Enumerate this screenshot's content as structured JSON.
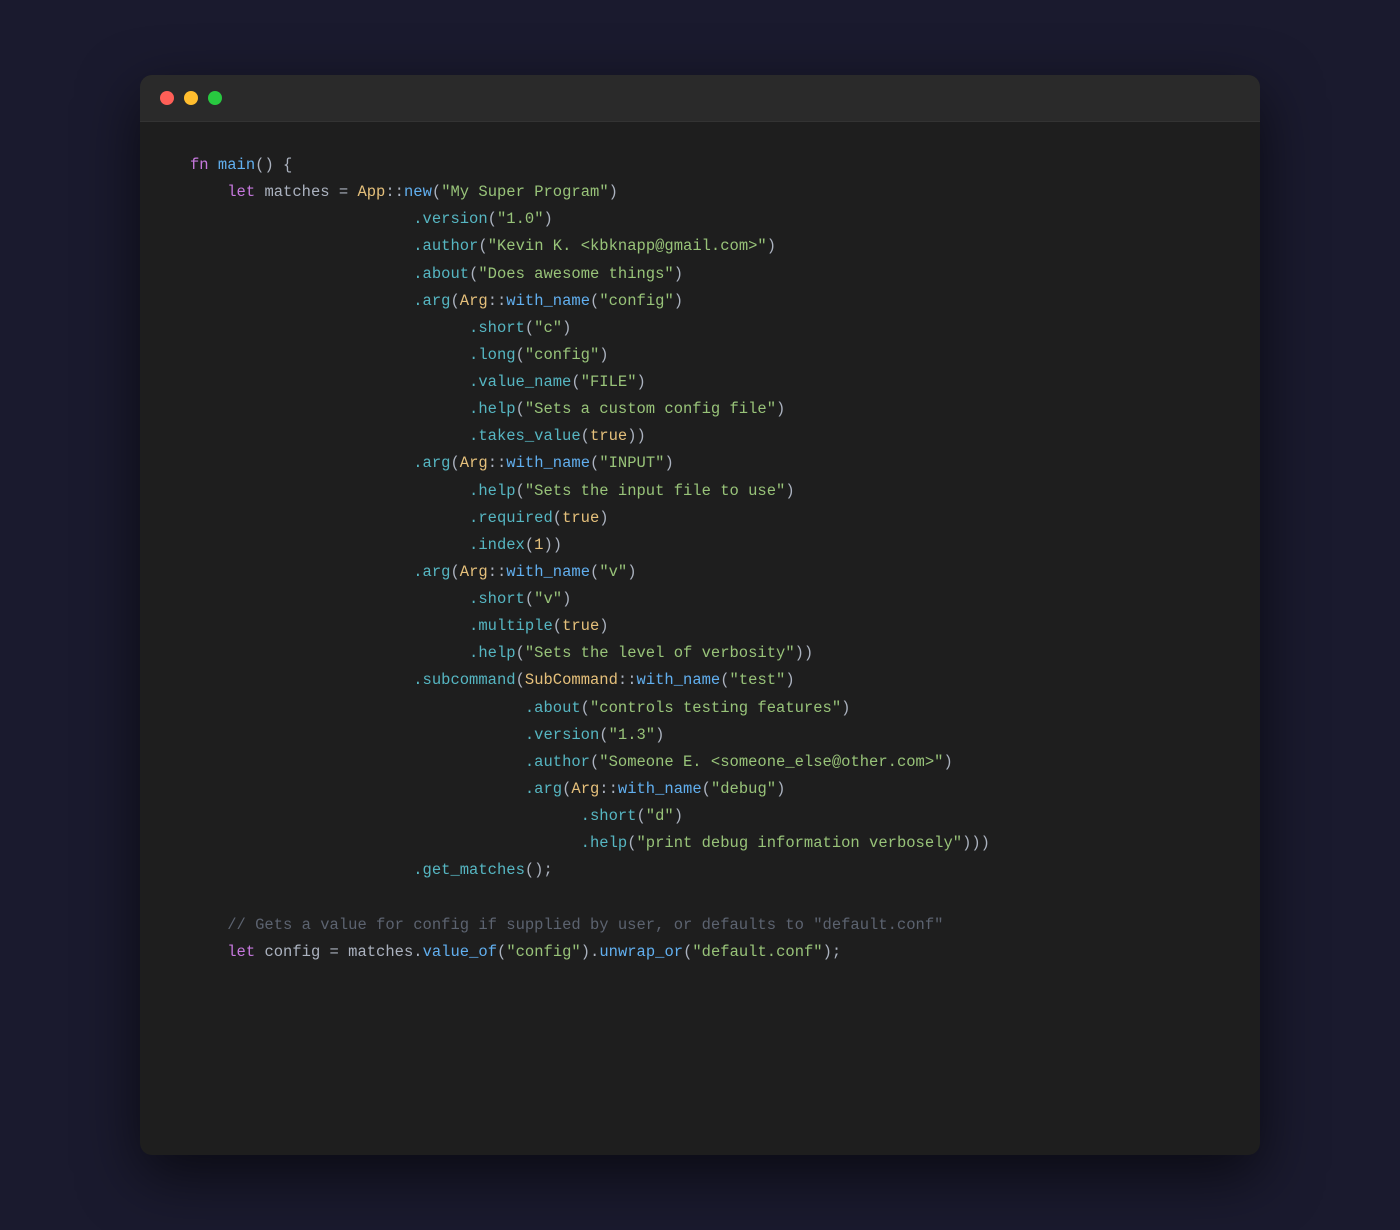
{
  "window": {
    "dots": [
      "red",
      "yellow",
      "green"
    ],
    "dot_labels": [
      "close-dot",
      "minimize-dot",
      "maximize-dot"
    ]
  },
  "code": {
    "lines": [
      {
        "id": 1,
        "content": "fn main() {"
      },
      {
        "id": 2,
        "content": "    let matches = App::new(\"My Super Program\")"
      },
      {
        "id": 3,
        "content": "                        .version(\"1.0\")"
      },
      {
        "id": 4,
        "content": "                        .author(\"Kevin K. <kbknapp@gmail.com>\")"
      },
      {
        "id": 5,
        "content": "                        .about(\"Does awesome things\")"
      },
      {
        "id": 6,
        "content": "                        .arg(Arg::with_name(\"config\")"
      },
      {
        "id": 7,
        "content": "                              .short(\"c\")"
      },
      {
        "id": 8,
        "content": "                              .long(\"config\")"
      },
      {
        "id": 9,
        "content": "                              .value_name(\"FILE\")"
      },
      {
        "id": 10,
        "content": "                              .help(\"Sets a custom config file\")"
      },
      {
        "id": 11,
        "content": "                              .takes_value(true))"
      },
      {
        "id": 12,
        "content": "                        .arg(Arg::with_name(\"INPUT\")"
      },
      {
        "id": 13,
        "content": "                              .help(\"Sets the input file to use\")"
      },
      {
        "id": 14,
        "content": "                              .required(true)"
      },
      {
        "id": 15,
        "content": "                              .index(1))"
      },
      {
        "id": 16,
        "content": "                        .arg(Arg::with_name(\"v\")"
      },
      {
        "id": 17,
        "content": "                              .short(\"v\")"
      },
      {
        "id": 18,
        "content": "                              .multiple(true)"
      },
      {
        "id": 19,
        "content": "                              .help(\"Sets the level of verbosity\"))"
      },
      {
        "id": 20,
        "content": "                        .subcommand(SubCommand::with_name(\"test\")"
      },
      {
        "id": 21,
        "content": "                                    .about(\"controls testing features\")"
      },
      {
        "id": 22,
        "content": "                                    .version(\"1.3\")"
      },
      {
        "id": 23,
        "content": "                                    .author(\"Someone E. <someone_else@other.com>\")"
      },
      {
        "id": 24,
        "content": "                                    .arg(Arg::with_name(\"debug\")"
      },
      {
        "id": 25,
        "content": "                                          .short(\"d\")"
      },
      {
        "id": 26,
        "content": "                                          .help(\"print debug information verbosely\")))"
      },
      {
        "id": 27,
        "content": "                        .get_matches();"
      },
      {
        "id": 28,
        "content": ""
      },
      {
        "id": 29,
        "content": "    // Gets a value for config if supplied by user, or defaults to \"default.conf\""
      },
      {
        "id": 30,
        "content": "    let config = matches.value_of(\"config\").unwrap_or(\"default.conf\");"
      }
    ]
  }
}
